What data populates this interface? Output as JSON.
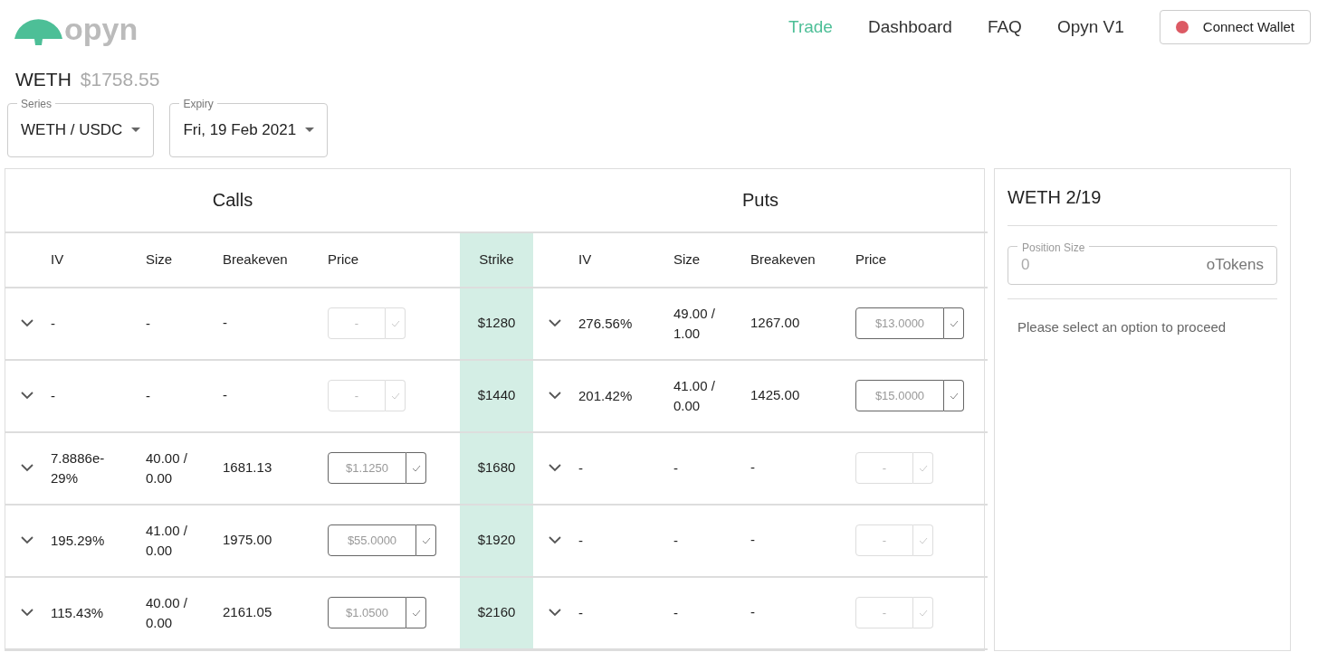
{
  "header": {
    "logo_text": "opyn",
    "nav": [
      {
        "label": "Trade",
        "selected": true
      },
      {
        "label": "Dashboard",
        "selected": false
      },
      {
        "label": "FAQ",
        "selected": false
      },
      {
        "label": "Opyn V1",
        "selected": false
      }
    ],
    "wallet_button": {
      "label": "Connect Wallet",
      "connected": false
    }
  },
  "asset": {
    "name": "WETH",
    "price": "$1758.55"
  },
  "selects": [
    {
      "label": "Series",
      "value": "WETH / USDC"
    },
    {
      "label": "Expiry",
      "value": "Fri, 19 Feb 2021"
    }
  ],
  "table": {
    "calls_title": "Calls",
    "puts_title": "Puts",
    "call_columns": [
      "IV",
      "Size",
      "Breakeven",
      "Price"
    ],
    "strike_column": "Strike",
    "put_columns": [
      "IV",
      "Size",
      "Breakeven",
      "Price"
    ],
    "rows": [
      {
        "strike": "$1280",
        "call": {
          "iv": "-",
          "size": "-",
          "breakeven": "-",
          "price": {
            "placeholder": "-",
            "disabled": true
          }
        },
        "put": {
          "iv": "276.56%",
          "size": "49.00 / 1.00",
          "breakeven": "1267.00",
          "price": {
            "placeholder": "$13.0000",
            "disabled": false
          }
        }
      },
      {
        "strike": "$1440",
        "call": {
          "iv": "-",
          "size": "-",
          "breakeven": "-",
          "price": {
            "placeholder": "-",
            "disabled": true
          }
        },
        "put": {
          "iv": "201.42%",
          "size": "41.00 / 0.00",
          "breakeven": "1425.00",
          "price": {
            "placeholder": "$15.0000",
            "disabled": false
          }
        }
      },
      {
        "strike": "$1680",
        "call": {
          "iv": "7.8886e-29%",
          "size": "40.00 / 0.00",
          "breakeven": "1681.13",
          "price": {
            "placeholder": "$1.1250",
            "disabled": false
          }
        },
        "put": {
          "iv": "-",
          "size": "-",
          "breakeven": "-",
          "price": {
            "placeholder": "-",
            "disabled": true
          }
        }
      },
      {
        "strike": "$1920",
        "call": {
          "iv": "195.29%",
          "size": "41.00 / 0.00",
          "breakeven": "1975.00",
          "price": {
            "placeholder": "$55.0000",
            "disabled": false
          }
        },
        "put": {
          "iv": "-",
          "size": "-",
          "breakeven": "-",
          "price": {
            "placeholder": "-",
            "disabled": true
          }
        }
      },
      {
        "strike": "$2160",
        "call": {
          "iv": "115.43%",
          "size": "40.00 / 0.00",
          "breakeven": "2161.05",
          "price": {
            "placeholder": "$1.0500",
            "disabled": false
          }
        },
        "put": {
          "iv": "-",
          "size": "-",
          "breakeven": "-",
          "price": {
            "placeholder": "-",
            "disabled": true
          }
        }
      }
    ]
  },
  "panel": {
    "title": "WETH 2/19",
    "position_size": {
      "label": "Position Size",
      "placeholder": "0",
      "unit": "oTokens"
    },
    "message": "Please select an option to proceed"
  }
}
